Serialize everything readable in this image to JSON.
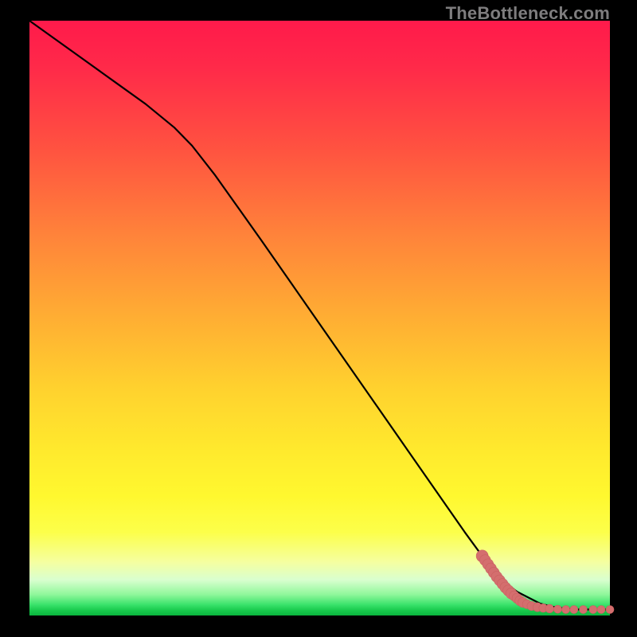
{
  "watermark": "TheBottleneck.com",
  "colors": {
    "line": "#000000",
    "marker_fill": "#d46e6e",
    "marker_stroke": "#c96060"
  },
  "chart_data": {
    "type": "line",
    "title": "",
    "xlabel": "",
    "ylabel": "",
    "xlim": [
      0,
      100
    ],
    "ylim": [
      0,
      100
    ],
    "grid": false,
    "legend": false,
    "annotations": [],
    "series": [
      {
        "name": "curve",
        "x": [
          0,
          5,
          10,
          15,
          20,
          25,
          28,
          32,
          36,
          40,
          45,
          50,
          55,
          60,
          65,
          70,
          75,
          78,
          80,
          82,
          84,
          86,
          88,
          90,
          92,
          94,
          96,
          98,
          100
        ],
        "y": [
          100,
          96.5,
          93,
          89.5,
          86,
          82,
          79,
          74,
          68.5,
          63,
          56,
          49,
          42,
          35,
          28,
          21,
          14,
          10,
          7.5,
          5.5,
          4,
          3,
          2,
          1.5,
          1.2,
          1,
          1,
          1,
          1
        ]
      }
    ],
    "markers": {
      "name": "highlighted-points",
      "series": "curve",
      "points": [
        {
          "x": 78,
          "y": 10,
          "r": 1.2
        },
        {
          "x": 78.5,
          "y": 9.3,
          "r": 1.1
        },
        {
          "x": 79,
          "y": 8.6,
          "r": 1.1
        },
        {
          "x": 79.5,
          "y": 7.9,
          "r": 1.1
        },
        {
          "x": 80,
          "y": 7.2,
          "r": 1.1
        },
        {
          "x": 80.5,
          "y": 6.5,
          "r": 1.1
        },
        {
          "x": 81,
          "y": 5.9,
          "r": 1.1
        },
        {
          "x": 81.5,
          "y": 5.3,
          "r": 1.1
        },
        {
          "x": 82,
          "y": 4.7,
          "r": 1.1
        },
        {
          "x": 82.5,
          "y": 4.2,
          "r": 1.1
        },
        {
          "x": 83,
          "y": 3.7,
          "r": 1.1
        },
        {
          "x": 83.5,
          "y": 3.3,
          "r": 1.0
        },
        {
          "x": 84,
          "y": 2.9,
          "r": 1.0
        },
        {
          "x": 84.5,
          "y": 2.5,
          "r": 1.0
        },
        {
          "x": 85,
          "y": 2.2,
          "r": 1.0
        },
        {
          "x": 85.7,
          "y": 1.9,
          "r": 0.9
        },
        {
          "x": 86.5,
          "y": 1.6,
          "r": 0.9
        },
        {
          "x": 87.5,
          "y": 1.4,
          "r": 0.9
        },
        {
          "x": 88.5,
          "y": 1.25,
          "r": 0.85
        },
        {
          "x": 89.6,
          "y": 1.15,
          "r": 0.85
        },
        {
          "x": 91,
          "y": 1.05,
          "r": 0.8
        },
        {
          "x": 92.4,
          "y": 1.0,
          "r": 0.8
        },
        {
          "x": 93.8,
          "y": 1.0,
          "r": 0.8
        },
        {
          "x": 95.4,
          "y": 1.0,
          "r": 0.8
        },
        {
          "x": 97.1,
          "y": 1.0,
          "r": 0.8
        },
        {
          "x": 98.5,
          "y": 1.0,
          "r": 0.8
        },
        {
          "x": 100,
          "y": 1.0,
          "r": 0.8
        }
      ]
    }
  }
}
